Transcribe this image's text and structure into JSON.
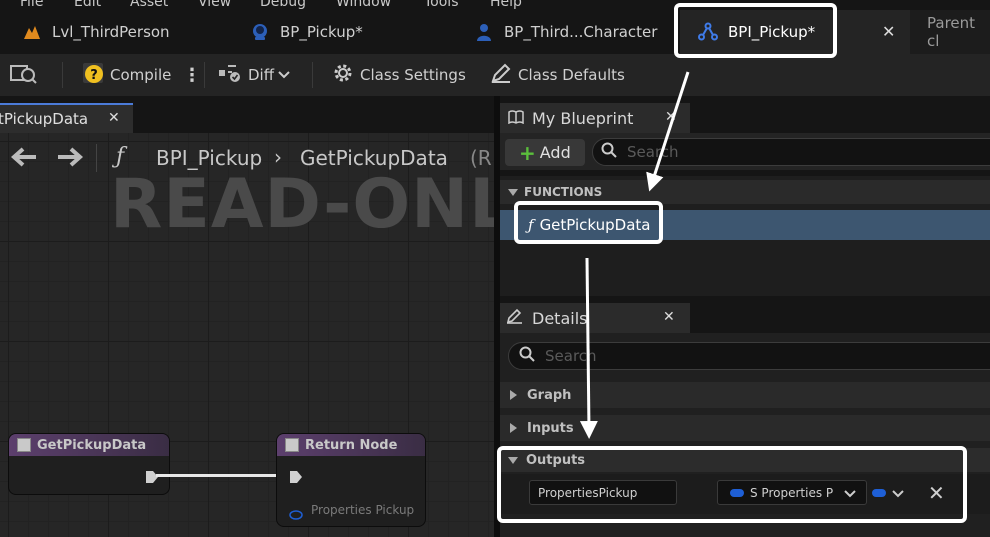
{
  "menu": [
    "File",
    "Edit",
    "Asset",
    "View",
    "Debug",
    "Window",
    "Tools",
    "Help"
  ],
  "tabs": [
    {
      "label": "Lvl_ThirdPerson",
      "icon": "level-icon"
    },
    {
      "label": "BP_Pickup*",
      "icon": "blueprint-icon"
    },
    {
      "label": "BP_Third...Character",
      "icon": "character-icon"
    },
    {
      "label": "BPI_Pickup*",
      "icon": "interface-icon"
    },
    {
      "label": "Parent cl",
      "icon": ""
    }
  ],
  "toolbar": {
    "compile": "Compile",
    "diff": "Diff",
    "class_settings": "Class Settings",
    "class_defaults": "Class Defaults"
  },
  "graph": {
    "tab_label": "tPickupData",
    "breadcrumb_root": "BPI_Pickup",
    "breadcrumb_leaf": "GetPickupData",
    "breadcrumb_tail": "(R",
    "watermark": "READ-ONLY",
    "node_entry": "GetPickupData",
    "node_return": "Return Node",
    "return_pin": "Properties Pickup"
  },
  "my_blueprint": {
    "title": "My Blueprint",
    "add": "Add",
    "search_placeholder": "Search",
    "functions_header": "FUNCTIONS",
    "function_item": "GetPickupData"
  },
  "details": {
    "title": "Details",
    "search_placeholder": "Search",
    "sections": [
      "Graph",
      "Inputs",
      "Outputs"
    ],
    "output_name": "PropertiesPickup",
    "output_type": "S Properties P"
  },
  "colors": {
    "accent_blue": "#4b7bd8",
    "highlight": "#ffffff",
    "selected_row": "#3d5670",
    "struct_pin": "#1e5fd6"
  }
}
